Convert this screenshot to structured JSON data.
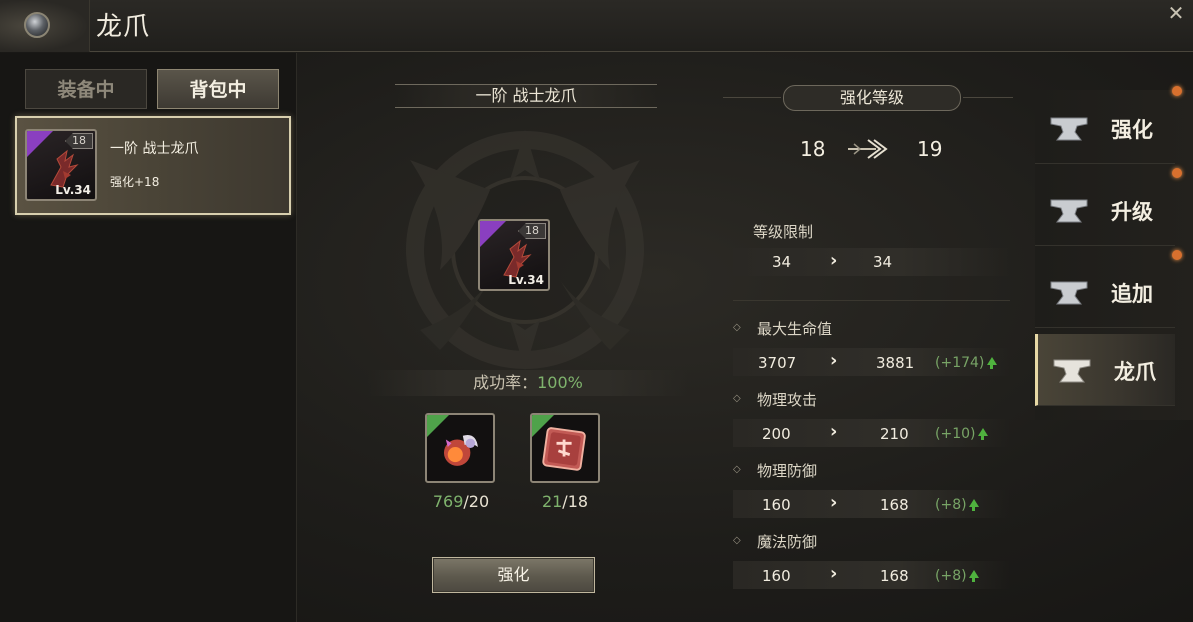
{
  "header": {
    "title": "龙爪",
    "close_icon": "close-icon"
  },
  "left_panel": {
    "tabs": [
      {
        "label": "装备中",
        "active": false
      },
      {
        "label": "背包中",
        "active": true
      }
    ],
    "item": {
      "name": "一阶 战士龙爪",
      "enhance": "强化+18",
      "badge": "18",
      "level": "Lv.34",
      "rarity_color": "#8a3fc0"
    }
  },
  "center": {
    "title": "一阶 战士龙爪",
    "item": {
      "badge": "18",
      "level": "Lv.34"
    },
    "success_label": "成功率：",
    "success_value": "100%",
    "materials": [
      {
        "icon": "enhance-stone-icon",
        "have": "769",
        "need": "/20"
      },
      {
        "icon": "enhance-scroll-icon",
        "have": "21",
        "need": "/18"
      }
    ],
    "enhance_button": "强化"
  },
  "stats": {
    "header": "强化等级",
    "level_from": "18",
    "level_to": "19",
    "level_limit": {
      "label": "等级限制",
      "from": "34",
      "to": "34"
    },
    "rows": [
      {
        "label": "最大生命值",
        "from": "3707",
        "to": "3881",
        "delta": "(+174)"
      },
      {
        "label": "物理攻击",
        "from": "200",
        "to": "210",
        "delta": "(+10)"
      },
      {
        "label": "物理防御",
        "from": "160",
        "to": "168",
        "delta": "(+8)"
      },
      {
        "label": "魔法防御",
        "from": "160",
        "to": "168",
        "delta": "(+8)"
      }
    ]
  },
  "nav": {
    "items": [
      {
        "label": "强化",
        "icon": "anvil-icon",
        "active": false,
        "notify": true
      },
      {
        "label": "升级",
        "icon": "anvil-icon",
        "active": false,
        "notify": true
      },
      {
        "label": "追加",
        "icon": "anvil-icon",
        "active": false,
        "notify": true
      },
      {
        "label": "龙爪",
        "icon": "anvil-icon",
        "active": true,
        "notify": false
      }
    ]
  },
  "colors": {
    "accent_green": "#7fb36d",
    "notify_dot": "#d8702e",
    "active_border": "#d8cfae"
  }
}
